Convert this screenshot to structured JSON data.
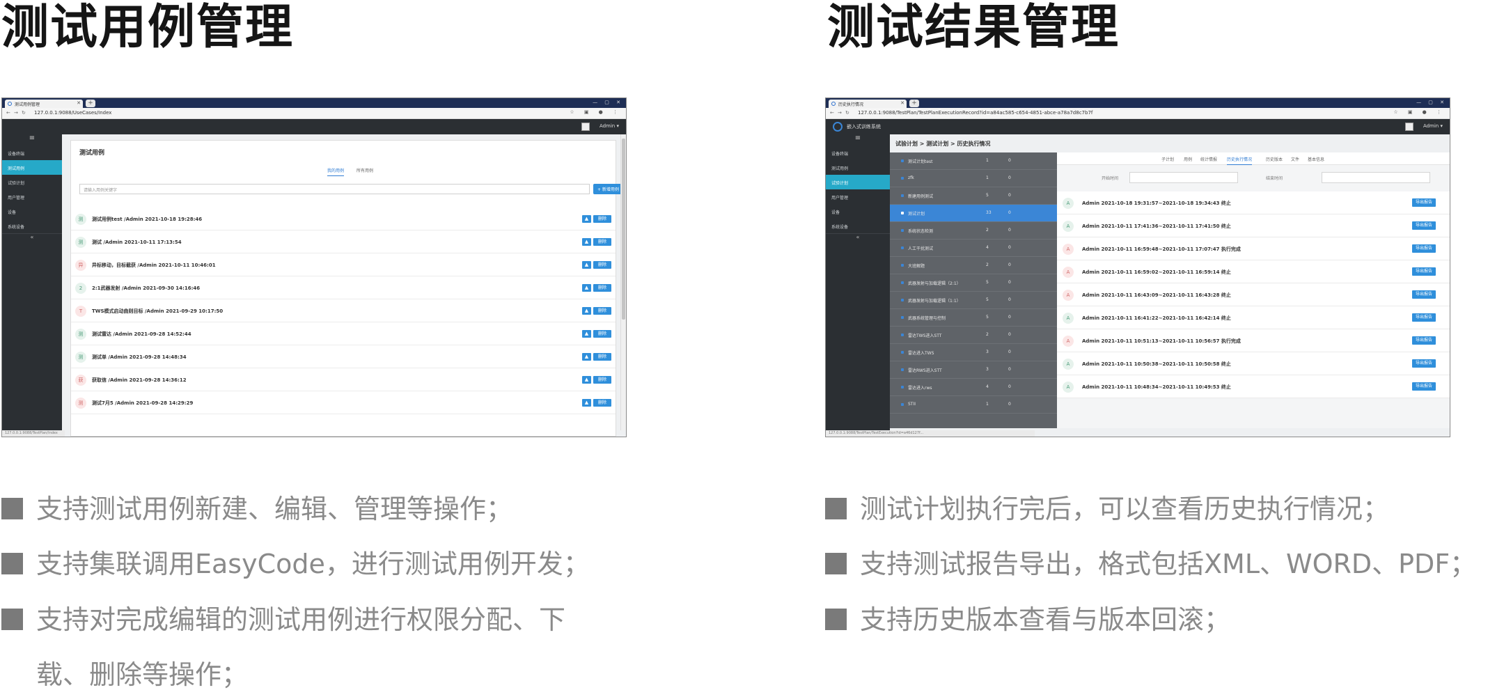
{
  "left": {
    "heading": "测试用例管理",
    "browser": {
      "tab_title": "测试用例管理",
      "url": "127.0.0.1:9088/UseCases/Index",
      "status_url": "127.0.0.1:9088/TestPlan/Index"
    },
    "admin_label": "Admin ▾",
    "sidebar": [
      "设备终端",
      "测试用例",
      "试验计划",
      "用户管理",
      "设备",
      "系统设备"
    ],
    "card_title": "测试用例",
    "tabs": [
      "我的用例",
      "所有用例"
    ],
    "search_placeholder": "请输入用例关键字",
    "new_button": "+ 新增用例",
    "delete_label": "删除",
    "download_icon": "▲",
    "cases": [
      {
        "avatar": "测",
        "text": "测试用例test /Admin 2021-10-18 19:28:46"
      },
      {
        "avatar": "测",
        "text": "测试 /Admin 2021-10-11 17:13:54"
      },
      {
        "avatar": "异",
        "text": "异标移动，目标截获 /Admin 2021-10-11 10:46:01"
      },
      {
        "avatar": "2",
        "text": "2:1武器发射 /Admin 2021-09-30 14:16:46"
      },
      {
        "avatar": "T",
        "text": "TWS模式启动曲则目标 /Admin 2021-09-29 10:17:50"
      },
      {
        "avatar": "测",
        "text": "测试雷达 /Admin 2021-09-28 14:52:44"
      },
      {
        "avatar": "测",
        "text": "测试单 /Admin 2021-09-28 14:48:34"
      },
      {
        "avatar": "获",
        "text": "获取信 /Admin 2021-09-28 14:36:12"
      },
      {
        "avatar": "测",
        "text": "测试7月5 /Admin 2021-09-28 14:29:29"
      }
    ]
  },
  "right": {
    "heading": "测试结果管理",
    "browser": {
      "tab_title": "历史执行情况",
      "url": "127.0.0.1:9088/TestPlan/TestPlanExecutionRecord?id=a84ac585-c654-4851-abce-a78a7d8c7b7f",
      "status_url": "127.0.0.1:9088/TestPlan/TestExecution?id=a46d127f..."
    },
    "app_name": "嵌入式训练系统",
    "admin_label": "Admin ▾",
    "sidebar": [
      "设备终端",
      "测试用例",
      "试验计划",
      "用户管理",
      "设备",
      "系统设备"
    ],
    "breadcrumb": "试验计划 > 测试计划 > 历史执行情况",
    "plans": [
      {
        "name": "测试计划test",
        "n": "1",
        "m": "0"
      },
      {
        "name": "zfk",
        "n": "1",
        "m": "0"
      },
      {
        "name": "新建用例测试",
        "n": "5",
        "m": "0"
      },
      {
        "name": "测试计划",
        "n": "33",
        "m": "0"
      },
      {
        "name": "系统状态检测",
        "n": "2",
        "m": "0"
      },
      {
        "name": "人工干扰测试",
        "n": "4",
        "m": "0"
      },
      {
        "name": "大班解题",
        "n": "2",
        "m": "0"
      },
      {
        "name": "武器发射与加载逻辑（2:1）",
        "n": "5",
        "m": "0"
      },
      {
        "name": "武器发射与加载逻辑（1:1）",
        "n": "5",
        "m": "0"
      },
      {
        "name": "武器系统管理与控制",
        "n": "5",
        "m": "0"
      },
      {
        "name": "雷达TWS进入STT",
        "n": "2",
        "m": "0"
      },
      {
        "name": "雷达进入TWS",
        "n": "3",
        "m": "0"
      },
      {
        "name": "雷达RWS进入STT",
        "n": "3",
        "m": "0"
      },
      {
        "name": "雷达进入rws",
        "n": "4",
        "m": "0"
      },
      {
        "name": "STII",
        "n": "1",
        "m": "0"
      }
    ],
    "tabs": [
      "子计划",
      "用例",
      "统计情报",
      "历史执行情况",
      "历史版本",
      "文件",
      "基本信息"
    ],
    "filter_start": "开始时间",
    "filter_end": "结束时间",
    "export_label": "导出报告",
    "history": [
      {
        "avatar": "A",
        "text": "Admin 2021-10-18 19:31:57~2021-10-18 19:34:43 终止"
      },
      {
        "avatar": "A",
        "text": "Admin 2021-10-11 17:41:36~2021-10-11 17:41:50 终止"
      },
      {
        "avatar": "A",
        "text": "Admin 2021-10-11 16:59:48~2021-10-11 17:07:47 执行完成"
      },
      {
        "avatar": "A",
        "text": "Admin 2021-10-11 16:59:02~2021-10-11 16:59:14 终止"
      },
      {
        "avatar": "A",
        "text": "Admin 2021-10-11 16:43:09~2021-10-11 16:43:28 终止"
      },
      {
        "avatar": "A",
        "text": "Admin 2021-10-11 16:41:22~2021-10-11 16:42:14 终止"
      },
      {
        "avatar": "A",
        "text": "Admin 2021-10-11 10:51:13~2021-10-11 10:56:57 执行完成"
      },
      {
        "avatar": "A",
        "text": "Admin 2021-10-11 10:50:38~2021-10-11 10:50:58 终止"
      },
      {
        "avatar": "A",
        "text": "Admin 2021-10-11 10:48:34~2021-10-11 10:49:53 终止"
      }
    ]
  },
  "bullets_left": [
    "支持测试用例新建、编辑、管理等操作；",
    "支持集联调用EasyCode，进行测试用例开发；",
    "支持对完成编辑的测试用例进行权限分配、下",
    "载、删除等操作；"
  ],
  "bullets_right": [
    "测试计划执行完后，可以查看历史执行情况；",
    "支持测试报告导出，格式包括XML、WORD、PDF；",
    "支持历史版本查看与版本回滚；"
  ]
}
